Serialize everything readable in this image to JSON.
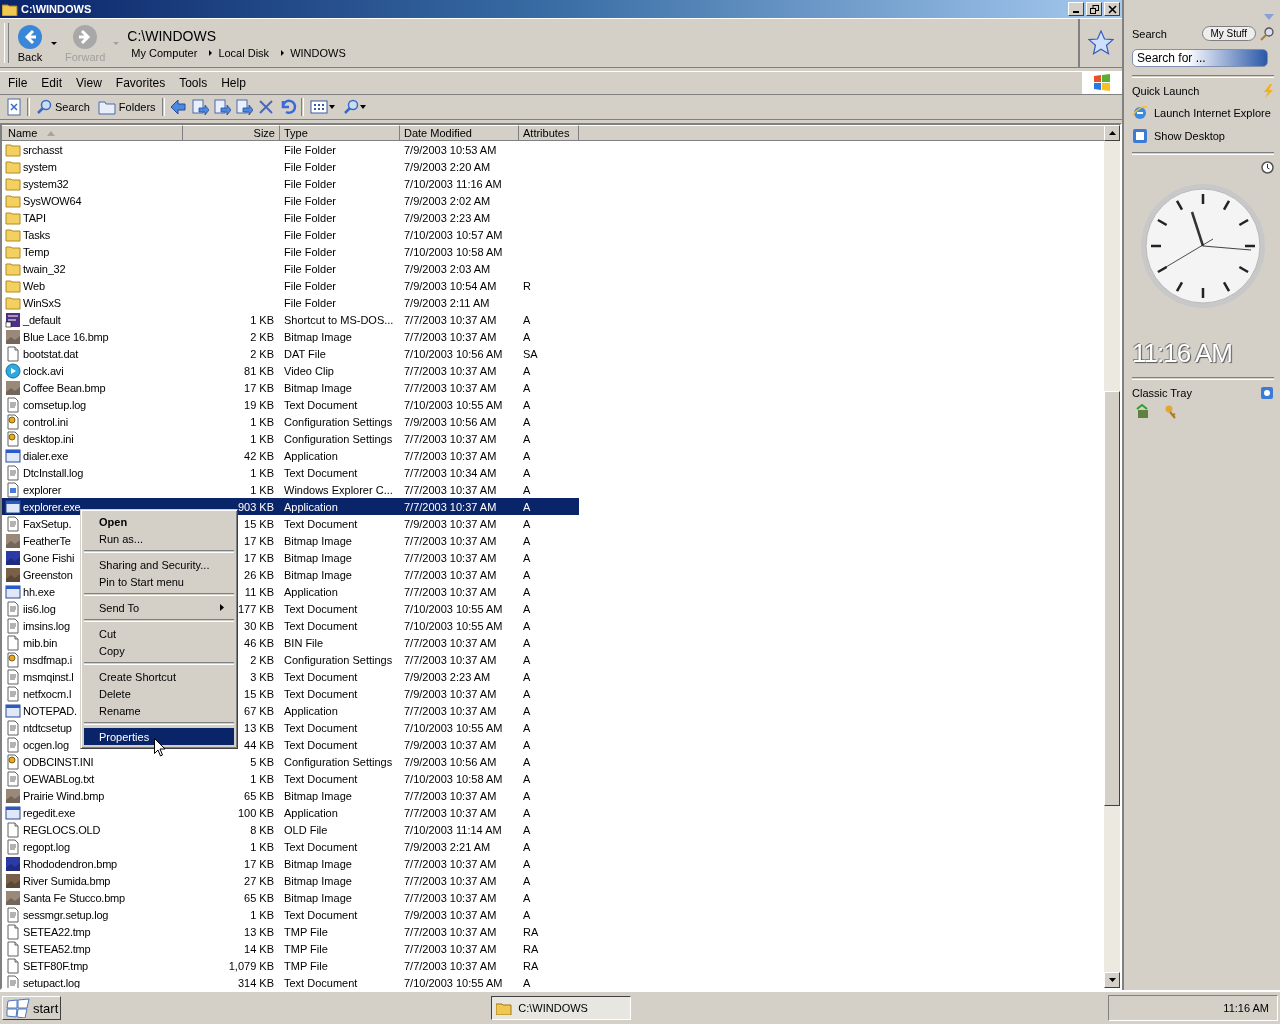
{
  "window": {
    "title": "C:\\WINDOWS"
  },
  "nav": {
    "back": {
      "label": "Back",
      "disabled": false
    },
    "forward": {
      "label": "Forward",
      "disabled": true
    },
    "path_title": "C:\\WINDOWS",
    "breadcrumb": [
      "My Computer",
      "Local Disk",
      "WINDOWS"
    ]
  },
  "menu": [
    "File",
    "Edit",
    "View",
    "Favorites",
    "Tools",
    "Help"
  ],
  "toolbar": [
    {
      "kind": "icon"
    },
    {
      "kind": "text",
      "label": "Search"
    },
    {
      "kind": "text",
      "label": "Folders"
    },
    {
      "kind": "icon"
    },
    {
      "kind": "icon"
    },
    {
      "kind": "icon"
    },
    {
      "kind": "icon"
    },
    {
      "kind": "icon"
    },
    {
      "kind": "icon"
    },
    {
      "kind": "dropdown"
    },
    {
      "kind": "dropdown"
    }
  ],
  "columns": [
    {
      "label": "Name",
      "sorted": true
    },
    {
      "label": "Size",
      "sorted": false
    },
    {
      "label": "Type",
      "sorted": false
    },
    {
      "label": "Date Modified",
      "sorted": false
    },
    {
      "label": "Attributes",
      "sorted": false
    }
  ],
  "rows": [
    {
      "name": "srchasst",
      "size": "",
      "type": "File Folder",
      "date": "7/9/2003 10:53 AM",
      "attr": "",
      "kind": "folder",
      "selected": false
    },
    {
      "name": "system",
      "size": "",
      "type": "File Folder",
      "date": "7/9/2003 2:20 AM",
      "attr": "",
      "kind": "folder",
      "selected": false
    },
    {
      "name": "system32",
      "size": "",
      "type": "File Folder",
      "date": "7/10/2003 11:16 AM",
      "attr": "",
      "kind": "folder",
      "selected": false
    },
    {
      "name": "SysWOW64",
      "size": "",
      "type": "File Folder",
      "date": "7/9/2003 2:02 AM",
      "attr": "",
      "kind": "folder",
      "selected": false
    },
    {
      "name": "TAPI",
      "size": "",
      "type": "File Folder",
      "date": "7/9/2003 2:23 AM",
      "attr": "",
      "kind": "folder",
      "selected": false
    },
    {
      "name": "Tasks",
      "size": "",
      "type": "File Folder",
      "date": "7/10/2003 10:57 AM",
      "attr": "",
      "kind": "folder",
      "selected": false
    },
    {
      "name": "Temp",
      "size": "",
      "type": "File Folder",
      "date": "7/10/2003 10:58 AM",
      "attr": "",
      "kind": "folder",
      "selected": false
    },
    {
      "name": "twain_32",
      "size": "",
      "type": "File Folder",
      "date": "7/9/2003 2:03 AM",
      "attr": "",
      "kind": "folder",
      "selected": false
    },
    {
      "name": "Web",
      "size": "",
      "type": "File Folder",
      "date": "7/9/2003 10:54 AM",
      "attr": "R",
      "kind": "folder",
      "selected": false
    },
    {
      "name": "WinSxS",
      "size": "",
      "type": "File Folder",
      "date": "7/9/2003 2:11 AM",
      "attr": "",
      "kind": "folder",
      "selected": false
    },
    {
      "name": "_default",
      "size": "1 KB",
      "type": "Shortcut to MS-DOS...",
      "date": "7/7/2003 10:37 AM",
      "attr": "A",
      "kind": "shortcut",
      "selected": false
    },
    {
      "name": "Blue Lace 16.bmp",
      "size": "2 KB",
      "type": "Bitmap Image",
      "date": "7/7/2003 10:37 AM",
      "attr": "A",
      "kind": "bitmap",
      "selected": false
    },
    {
      "name": "bootstat.dat",
      "size": "2 KB",
      "type": "DAT File",
      "date": "7/10/2003 10:56 AM",
      "attr": "SA",
      "kind": "file",
      "selected": false
    },
    {
      "name": "clock.avi",
      "size": "81 KB",
      "type": "Video Clip",
      "date": "7/7/2003 10:37 AM",
      "attr": "A",
      "kind": "video",
      "selected": false
    },
    {
      "name": "Coffee Bean.bmp",
      "size": "17 KB",
      "type": "Bitmap Image",
      "date": "7/7/2003 10:37 AM",
      "attr": "A",
      "kind": "bitmap",
      "selected": false
    },
    {
      "name": "comsetup.log",
      "size": "19 KB",
      "type": "Text Document",
      "date": "7/10/2003 10:55 AM",
      "attr": "A",
      "kind": "text",
      "selected": false
    },
    {
      "name": "control.ini",
      "size": "1 KB",
      "type": "Configuration Settings",
      "date": "7/9/2003 10:56 AM",
      "attr": "A",
      "kind": "config",
      "selected": false
    },
    {
      "name": "desktop.ini",
      "size": "1 KB",
      "type": "Configuration Settings",
      "date": "7/7/2003 10:37 AM",
      "attr": "A",
      "kind": "config",
      "selected": false
    },
    {
      "name": "dialer.exe",
      "size": "42 KB",
      "type": "Application",
      "date": "7/7/2003 10:37 AM",
      "attr": "A",
      "kind": "app",
      "selected": false
    },
    {
      "name": "DtcInstall.log",
      "size": "1 KB",
      "type": "Text Document",
      "date": "7/7/2003 10:34 AM",
      "attr": "A",
      "kind": "text",
      "selected": false
    },
    {
      "name": "explorer",
      "size": "1 KB",
      "type": "Windows Explorer C...",
      "date": "7/7/2003 10:37 AM",
      "attr": "A",
      "kind": "explorer",
      "selected": false
    },
    {
      "name": "explorer.exe",
      "size": "903 KB",
      "type": "Application",
      "date": "7/7/2003 10:37 AM",
      "attr": "A",
      "kind": "app",
      "selected": true
    },
    {
      "name": "FaxSetup.",
      "size": "15 KB",
      "type": "Text Document",
      "date": "7/9/2003 10:37 AM",
      "attr": "A",
      "kind": "text",
      "selected": false
    },
    {
      "name": "FeatherTe",
      "size": "17 KB",
      "type": "Bitmap Image",
      "date": "7/7/2003 10:37 AM",
      "attr": "A",
      "kind": "bitmap",
      "selected": false
    },
    {
      "name": "Gone Fishi",
      "size": "17 KB",
      "type": "Bitmap Image",
      "date": "7/7/2003 10:37 AM",
      "attr": "A",
      "kind": "bitmap",
      "selected": false
    },
    {
      "name": "Greenston",
      "size": "26 KB",
      "type": "Bitmap Image",
      "date": "7/7/2003 10:37 AM",
      "attr": "A",
      "kind": "bitmap",
      "selected": false
    },
    {
      "name": "hh.exe",
      "size": "11 KB",
      "type": "Application",
      "date": "7/7/2003 10:37 AM",
      "attr": "A",
      "kind": "app",
      "selected": false
    },
    {
      "name": "iis6.log",
      "size": "177 KB",
      "type": "Text Document",
      "date": "7/10/2003 10:55 AM",
      "attr": "A",
      "kind": "text",
      "selected": false
    },
    {
      "name": "imsins.log",
      "size": "30 KB",
      "type": "Text Document",
      "date": "7/10/2003 10:55 AM",
      "attr": "A",
      "kind": "text",
      "selected": false
    },
    {
      "name": "mib.bin",
      "size": "46 KB",
      "type": "BIN File",
      "date": "7/7/2003 10:37 AM",
      "attr": "A",
      "kind": "file",
      "selected": false
    },
    {
      "name": "msdfmap.i",
      "size": "2 KB",
      "type": "Configuration Settings",
      "date": "7/7/2003 10:37 AM",
      "attr": "A",
      "kind": "config",
      "selected": false
    },
    {
      "name": "msmqinst.l",
      "size": "3 KB",
      "type": "Text Document",
      "date": "7/9/2003 2:23 AM",
      "attr": "A",
      "kind": "text",
      "selected": false
    },
    {
      "name": "netfxocm.l",
      "size": "15 KB",
      "type": "Text Document",
      "date": "7/9/2003 10:37 AM",
      "attr": "A",
      "kind": "text",
      "selected": false
    },
    {
      "name": "NOTEPAD.",
      "size": "67 KB",
      "type": "Application",
      "date": "7/7/2003 10:37 AM",
      "attr": "A",
      "kind": "app",
      "selected": false
    },
    {
      "name": "ntdtcsetup",
      "size": "13 KB",
      "type": "Text Document",
      "date": "7/10/2003 10:55 AM",
      "attr": "A",
      "kind": "text",
      "selected": false
    },
    {
      "name": "ocgen.log",
      "size": "44 KB",
      "type": "Text Document",
      "date": "7/9/2003 10:37 AM",
      "attr": "A",
      "kind": "text",
      "selected": false
    },
    {
      "name": "ODBCINST.INI",
      "size": "5 KB",
      "type": "Configuration Settings",
      "date": "7/9/2003 10:56 AM",
      "attr": "A",
      "kind": "config",
      "selected": false
    },
    {
      "name": "OEWABLog.txt",
      "size": "1 KB",
      "type": "Text Document",
      "date": "7/10/2003 10:58 AM",
      "attr": "A",
      "kind": "text",
      "selected": false
    },
    {
      "name": "Prairie Wind.bmp",
      "size": "65 KB",
      "type": "Bitmap Image",
      "date": "7/7/2003 10:37 AM",
      "attr": "A",
      "kind": "bitmap",
      "selected": false
    },
    {
      "name": "regedit.exe",
      "size": "100 KB",
      "type": "Application",
      "date": "7/7/2003 10:37 AM",
      "attr": "A",
      "kind": "app",
      "selected": false
    },
    {
      "name": "REGLOCS.OLD",
      "size": "8 KB",
      "type": "OLD File",
      "date": "7/10/2003 11:14 AM",
      "attr": "A",
      "kind": "file",
      "selected": false
    },
    {
      "name": "regopt.log",
      "size": "1 KB",
      "type": "Text Document",
      "date": "7/9/2003 2:21 AM",
      "attr": "A",
      "kind": "text",
      "selected": false
    },
    {
      "name": "Rhododendron.bmp",
      "size": "17 KB",
      "type": "Bitmap Image",
      "date": "7/7/2003 10:37 AM",
      "attr": "A",
      "kind": "bitmap",
      "selected": false
    },
    {
      "name": "River Sumida.bmp",
      "size": "27 KB",
      "type": "Bitmap Image",
      "date": "7/7/2003 10:37 AM",
      "attr": "A",
      "kind": "bitmap",
      "selected": false
    },
    {
      "name": "Santa Fe Stucco.bmp",
      "size": "65 KB",
      "type": "Bitmap Image",
      "date": "7/7/2003 10:37 AM",
      "attr": "A",
      "kind": "bitmap",
      "selected": false
    },
    {
      "name": "sessmgr.setup.log",
      "size": "1 KB",
      "type": "Text Document",
      "date": "7/9/2003 10:37 AM",
      "attr": "A",
      "kind": "text",
      "selected": false
    },
    {
      "name": "SETEA22.tmp",
      "size": "13 KB",
      "type": "TMP File",
      "date": "7/7/2003 10:37 AM",
      "attr": "RA",
      "kind": "file",
      "selected": false
    },
    {
      "name": "SETEA52.tmp",
      "size": "14 KB",
      "type": "TMP File",
      "date": "7/7/2003 10:37 AM",
      "attr": "RA",
      "kind": "file",
      "selected": false
    },
    {
      "name": "SETF80F.tmp",
      "size": "1,079 KB",
      "type": "TMP File",
      "date": "7/7/2003 10:37 AM",
      "attr": "RA",
      "kind": "file",
      "selected": false
    },
    {
      "name": "setupact.log",
      "size": "314 KB",
      "type": "Text Document",
      "date": "7/10/2003 10:55 AM",
      "attr": "A",
      "kind": "text",
      "selected": false
    }
  ],
  "context_menu": [
    {
      "kind": "item",
      "label": "Open",
      "default": true,
      "selected": false
    },
    {
      "kind": "item",
      "label": "Run as...",
      "default": false,
      "selected": false
    },
    {
      "kind": "separator"
    },
    {
      "kind": "item",
      "label": "Sharing and Security...",
      "default": false,
      "selected": false
    },
    {
      "kind": "item",
      "label": "Pin to Start menu",
      "default": false,
      "selected": false
    },
    {
      "kind": "separator"
    },
    {
      "kind": "submenu",
      "label": "Send To",
      "default": false,
      "selected": false
    },
    {
      "kind": "separator"
    },
    {
      "kind": "item",
      "label": "Cut",
      "default": false,
      "selected": false
    },
    {
      "kind": "item",
      "label": "Copy",
      "default": false,
      "selected": false
    },
    {
      "kind": "separator"
    },
    {
      "kind": "item",
      "label": "Create Shortcut",
      "default": false,
      "selected": false
    },
    {
      "kind": "item",
      "label": "Delete",
      "default": false,
      "selected": false
    },
    {
      "kind": "item",
      "label": "Rename",
      "default": false,
      "selected": false
    },
    {
      "kind": "separator"
    },
    {
      "kind": "item",
      "label": "Properties",
      "default": false,
      "selected": true
    }
  ],
  "sidebar": {
    "search": {
      "title": "Search",
      "scope_button": "My Stuff",
      "placeholder": "Search for ..."
    },
    "quick_launch": {
      "title": "Quick Launch",
      "items": [
        {
          "label": "Launch Internet Explore"
        },
        {
          "label": "Show Desktop"
        }
      ]
    },
    "clock": {
      "time": "11:16 AM"
    },
    "tray": {
      "title": "Classic Tray"
    }
  },
  "taskbar": {
    "start": "start",
    "tasks": [
      {
        "label": "C:\\WINDOWS",
        "selected": true
      }
    ],
    "clock": "11:16 AM"
  }
}
